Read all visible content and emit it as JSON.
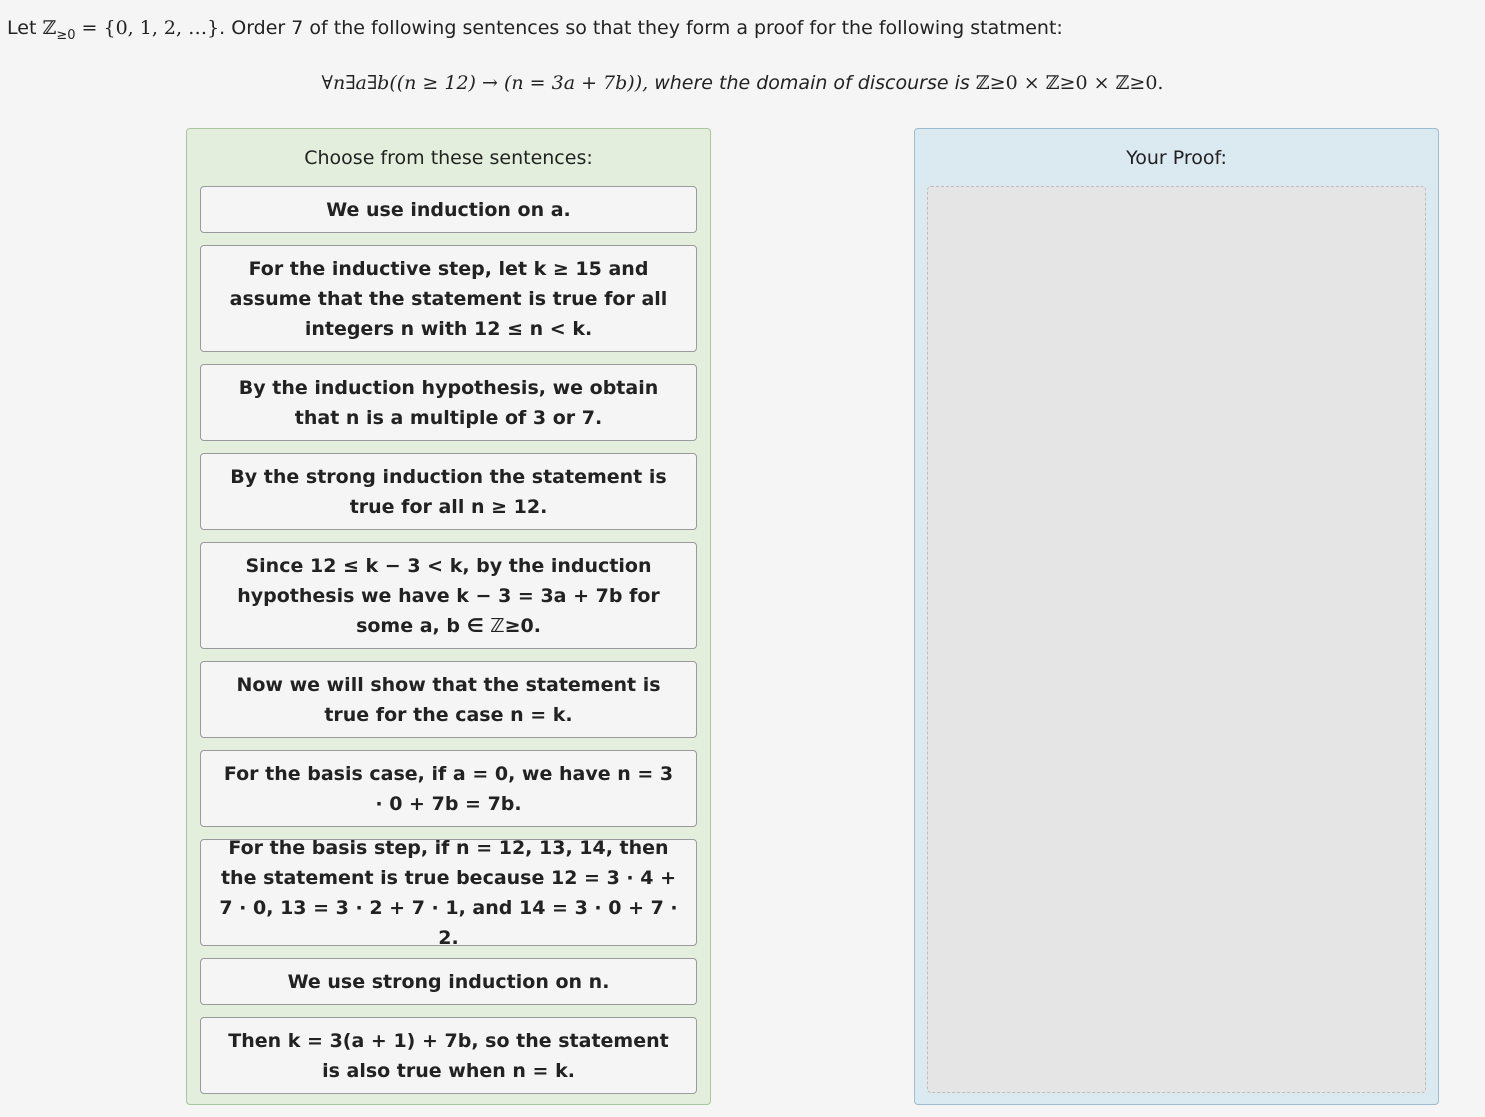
{
  "intro": {
    "let": "Let ",
    "zset": "ℤ",
    "sub": "≥0",
    "eq": " = {0, 1, 2, …}",
    "rest": ". Order 7 of the following sentences so that they form a proof for the following statment:"
  },
  "statement": {
    "formula": "∀n∃a∃b((n ≥ 12) → (n = 3a + 7b)),",
    "where": " where the domain of discourse is ",
    "domain": "ℤ≥0 × ℤ≥0 × ℤ≥0."
  },
  "left_panel": {
    "title": "Choose from these sentences:"
  },
  "right_panel": {
    "title": "Your Proof:"
  },
  "sentences": [
    {
      "text": "We use induction on a."
    },
    {
      "text": "For the inductive step, let k ≥ 15 and assume that the statement is true for all integers n with 12 ≤ n < k."
    },
    {
      "text": "By the induction hypothesis, we obtain that n is a multiple of 3 or 7."
    },
    {
      "text": "By the strong induction the statement is true for all n ≥ 12."
    },
    {
      "text": "Since 12 ≤ k − 3 < k, by the induction hypothesis we have k − 3 = 3a + 7b for some a, b ∈ ℤ≥0."
    },
    {
      "text": "Now we will show that the statement is true for the case n = k."
    },
    {
      "text": "For the basis case, if a = 0, we have n = 3 · 0 + 7b = 7b."
    },
    {
      "text": "For the basis step, if n = 12, 13, 14, then the statement is true because 12 = 3 · 4 + 7 · 0, 13 = 3 · 2 + 7 · 1, and 14 = 3 · 0 + 7 · 2."
    },
    {
      "text": "We use strong induction on n."
    },
    {
      "text": "Then k = 3(a + 1) + 7b, so the statement is also true when n = k."
    }
  ]
}
